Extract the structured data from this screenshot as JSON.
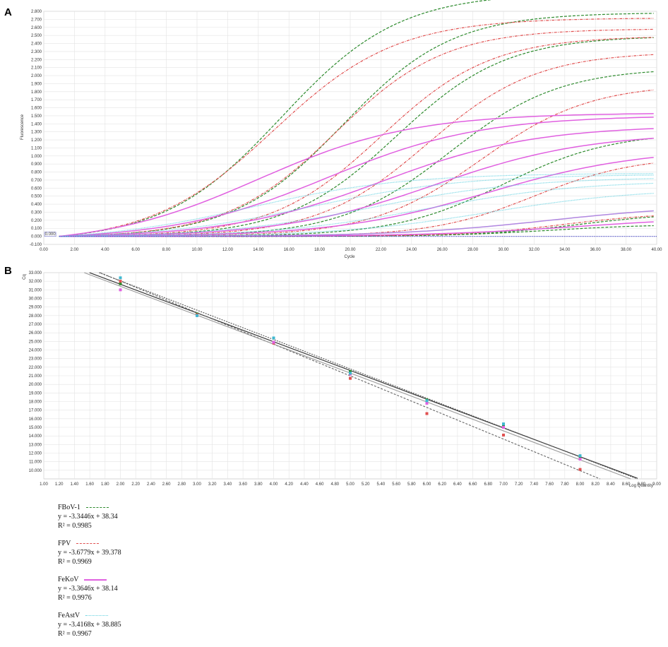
{
  "chart_data": [
    {
      "type": "line",
      "panel": "A",
      "xlabel": "Cycle",
      "ylabel": "Fluorescence",
      "xlim": [
        0,
        40
      ],
      "ylim": [
        -0.1,
        2.8
      ],
      "x_ticks": [
        "0.00",
        "2.00",
        "4.00",
        "6.00",
        "8.00",
        "10.00",
        "12.00",
        "14.00",
        "16.00",
        "18.00",
        "20.00",
        "22.00",
        "24.00",
        "26.00",
        "28.00",
        "30.00",
        "32.00",
        "34.00",
        "36.00",
        "38.00",
        "40.00"
      ],
      "y_ticks": [
        "-0.100",
        "0.000",
        "0.100",
        "0.200",
        "0.300",
        "0.400",
        "0.500",
        "0.600",
        "0.700",
        "0.800",
        "0.900",
        "1.000",
        "1.100",
        "1.200",
        "1.300",
        "1.400",
        "1.500",
        "1.600",
        "1.700",
        "1.800",
        "1.900",
        "2.000",
        "2.100",
        "2.200",
        "2.300",
        "2.400",
        "2.500",
        "2.600",
        "2.700",
        "2.800"
      ],
      "threshold": 0.0,
      "threshold_label": "0.000",
      "grid": true,
      "series": [
        {
          "assay": "FBoV-1",
          "color": "#2e8b2e",
          "style": "dashed",
          "curves": [
            {
              "ct": 15.5,
              "plateau": 3.1,
              "k": 0.26
            },
            {
              "ct": 19.5,
              "plateau": 2.8,
              "k": 0.28
            },
            {
              "ct": 23.0,
              "plateau": 2.5,
              "k": 0.28
            },
            {
              "ct": 26.5,
              "plateau": 2.1,
              "k": 0.28
            },
            {
              "ct": 30.0,
              "plateau": 1.3,
              "k": 0.28
            },
            {
              "ct": 33.0,
              "plateau": 0.15,
              "k": 0.3
            },
            {
              "ct": 35.0,
              "plateau": 0.3,
              "k": 0.3
            }
          ]
        },
        {
          "assay": "FPV",
          "color": "#e05050",
          "style": "dashdot",
          "curves": [
            {
              "ct": 15.0,
              "plateau": 2.8,
              "k": 0.25
            },
            {
              "ct": 19.0,
              "plateau": 2.6,
              "k": 0.28
            },
            {
              "ct": 22.0,
              "plateau": 2.5,
              "k": 0.28
            },
            {
              "ct": 25.0,
              "plateau": 2.3,
              "k": 0.28
            },
            {
              "ct": 28.5,
              "plateau": 1.9,
              "k": 0.28
            },
            {
              "ct": 32.0,
              "plateau": 1.0,
              "k": 0.3
            },
            {
              "ct": 34.0,
              "plateau": 0.3,
              "k": 0.3
            }
          ]
        },
        {
          "assay": "FeKoV",
          "color": "#e060e0",
          "style": "solid",
          "curves": [
            {
              "ct": 14.0,
              "plateau": 1.65,
              "k": 0.2
            },
            {
              "ct": 18.5,
              "plateau": 1.55,
              "k": 0.2
            },
            {
              "ct": 22.0,
              "plateau": 1.4,
              "k": 0.2
            },
            {
              "ct": 25.5,
              "plateau": 1.3,
              "k": 0.2
            },
            {
              "ct": 29.0,
              "plateau": 1.1,
              "k": 0.2
            },
            {
              "ct": 33.0,
              "plateau": 0.4,
              "k": 0.2
            },
            {
              "ct": 35.0,
              "plateau": 0.25,
              "k": 0.2
            }
          ]
        },
        {
          "assay": "FeAstV",
          "color": "#5fd0e0",
          "style": "dotted",
          "curves": [
            {
              "ct": 13.5,
              "plateau": 0.85,
              "k": 0.2
            },
            {
              "ct": 17.5,
              "plateau": 0.8,
              "k": 0.2
            },
            {
              "ct": 21.5,
              "plateau": 0.75,
              "k": 0.2
            },
            {
              "ct": 25.0,
              "plateau": 0.7,
              "k": 0.2
            },
            {
              "ct": 29.0,
              "plateau": 0.6,
              "k": 0.2
            },
            {
              "ct": 33.0,
              "plateau": 0.4,
              "k": 0.2
            }
          ]
        }
      ]
    },
    {
      "type": "scatter",
      "panel": "B",
      "xlabel": "Log Quantity",
      "ylabel": "Cq",
      "xlim": [
        1.0,
        9.0
      ],
      "ylim": [
        9.0,
        33.0
      ],
      "x_ticks": [
        "1.00",
        "1.20",
        "1.40",
        "1.60",
        "1.80",
        "2.00",
        "2.20",
        "2.40",
        "2.60",
        "2.80",
        "3.00",
        "3.20",
        "3.40",
        "3.60",
        "3.80",
        "4.00",
        "4.20",
        "4.40",
        "4.60",
        "4.80",
        "5.00",
        "5.20",
        "5.40",
        "5.60",
        "5.80",
        "6.00",
        "6.20",
        "6.40",
        "6.60",
        "6.80",
        "7.00",
        "7.20",
        "7.40",
        "7.60",
        "7.80",
        "8.00",
        "8.20",
        "8.40",
        "8.60",
        "8.80",
        "9.00"
      ],
      "y_ticks": [
        "10.000",
        "11.000",
        "12.000",
        "13.000",
        "14.000",
        "15.000",
        "16.000",
        "17.000",
        "18.000",
        "19.000",
        "20.000",
        "21.000",
        "22.000",
        "23.000",
        "24.000",
        "25.000",
        "26.000",
        "27.000",
        "28.000",
        "29.000",
        "30.000",
        "31.000",
        "32.000",
        "33.000"
      ],
      "grid": true,
      "series": [
        {
          "assay": "FBoV-1",
          "color": "#2e8b2e",
          "slope": -3.3446,
          "intercept": 38.34,
          "x": [
            2,
            3,
            4,
            5,
            6,
            7,
            8
          ],
          "y": [
            31.7,
            28.2,
            24.9,
            21.5,
            18.2,
            15.3,
            11.6
          ]
        },
        {
          "assay": "FPV",
          "color": "#e05050",
          "slope": -3.6779,
          "intercept": 39.378,
          "x": [
            2,
            3,
            4,
            5,
            6,
            7,
            8
          ],
          "y": [
            32.0,
            28.1,
            24.8,
            20.7,
            16.6,
            14.1,
            10.1
          ]
        },
        {
          "assay": "FeKoV",
          "color": "#e060e0",
          "slope": -3.3646,
          "intercept": 38.14,
          "x": [
            2,
            3,
            4,
            5,
            6,
            7,
            8
          ],
          "y": [
            31.0,
            28.0,
            24.9,
            21.2,
            17.8,
            15.0,
            11.3
          ]
        },
        {
          "assay": "FeAstV",
          "color": "#3fb8d0",
          "slope": -3.4168,
          "intercept": 38.885,
          "x": [
            2,
            3,
            4,
            5,
            6,
            7,
            8
          ],
          "y": [
            32.4,
            28.0,
            25.4,
            21.3,
            18.1,
            15.4,
            11.7
          ]
        }
      ]
    }
  ],
  "panels": {
    "a_label": "A",
    "b_label": "B"
  },
  "legend": [
    {
      "name": "FBoV-1",
      "equation": "y = -3.3446x + 38.34",
      "r2": "R² = 0.9985",
      "color": "#2e8b2e",
      "style": "dashed"
    },
    {
      "name": "FPV",
      "equation": "y = -3.6779x + 39.378",
      "r2": "R² = 0.9969",
      "color": "#e05050",
      "style": "dashdot"
    },
    {
      "name": "FeKoV",
      "equation": "y = -3.3646x + 38.14",
      "r2": "R² = 0.9976",
      "color": "#e060e0",
      "style": "solid"
    },
    {
      "name": "FeAstV",
      "equation": "y = -3.4168x + 38.885",
      "r2": "R² = 0.9967",
      "color": "#5fd0e0",
      "style": "dotted"
    }
  ]
}
